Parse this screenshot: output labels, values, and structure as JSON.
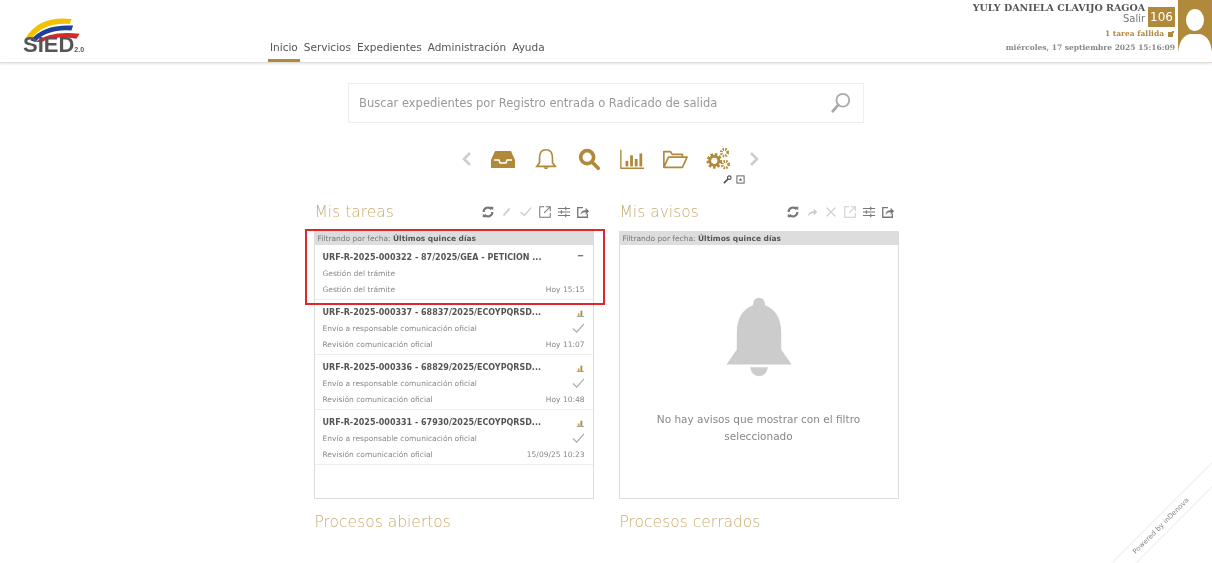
{
  "header": {
    "logo": {
      "text": "SIED",
      "version": "2.0"
    },
    "nav": [
      {
        "label": "Inicio",
        "selected": true
      },
      {
        "label": "Servicios",
        "selected": false
      },
      {
        "label": "Expedientes",
        "selected": false
      },
      {
        "label": "Administración",
        "selected": false
      },
      {
        "label": "Ayuda",
        "selected": false
      }
    ],
    "user": {
      "name": "YULY DANIELA CLAVIJO RAGOA",
      "logout": "Salir",
      "badge": "106",
      "failed_tasks": "1 tarea fallida",
      "datetime": "miércoles, 17 septiembre 2025 15:16:09"
    }
  },
  "search": {
    "placeholder": "Buscar expedientes por Registro entrada o Radicado de salida"
  },
  "panels": [
    {
      "title": "Mis tareas",
      "tools": [
        {
          "kind": "refresh",
          "disabled": false
        },
        {
          "kind": "edit",
          "disabled": true
        },
        {
          "kind": "check",
          "disabled": true
        },
        {
          "kind": "open",
          "disabled": false
        },
        {
          "kind": "filter",
          "disabled": false
        },
        {
          "kind": "share",
          "disabled": false
        }
      ],
      "filter": "Filtrando por fecha: **Últimos quince días**",
      "tasks": [
        {
          "title": "URF-R-2025-000322 - 87/2025/GEA - PETICION ...",
          "line_1": "Gestión del trámite",
          "line_2": "Gestión del trámite",
          "time": "Hoy 15:15",
          "kind": "pending",
          "highlighted": true
        },
        {
          "title": "URF-R-2025-000337 - 68837/2025/ECOYPQRSD...",
          "line_1": "Envío a responsable comunicación oficial",
          "line_2": "Revisión comunicación oficial",
          "time": "Hoy 11:07",
          "kind": "sent",
          "highlighted": false
        },
        {
          "title": "URF-R-2025-000336 - 68829/2025/ECOYPQRSD...",
          "line_1": "Envío a responsable comunicación oficial",
          "line_2": "Revisión comunicación oficial",
          "time": "Hoy 10:48",
          "kind": "sent",
          "highlighted": false
        },
        {
          "title": "URF-R-2025-000331 - 67930/2025/ECOYPQRSD...",
          "line_1": "Envío a responsable comunicación oficial",
          "line_2": "Revisión comunicación oficial",
          "time": "15/09/25 10:23",
          "kind": "sent",
          "highlighted": false
        }
      ]
    },
    {
      "title": "Mis avisos",
      "tools": [
        {
          "kind": "refresh",
          "disabled": false
        },
        {
          "kind": "forward",
          "disabled": true
        },
        {
          "kind": "close",
          "disabled": true
        },
        {
          "kind": "open",
          "disabled": true
        },
        {
          "kind": "filter",
          "disabled": false
        },
        {
          "kind": "share",
          "disabled": false
        }
      ],
      "filter": "Filtrando por fecha: **Últimos quince días**",
      "empty_message": "No hay avisos que mostrar con el filtro seleccionado"
    }
  ],
  "bottom_panels": [
    {
      "title": "Procesos abiertos"
    },
    {
      "title": "Procesos cerrados"
    }
  ],
  "ribbon": "Powered by inDenova"
}
